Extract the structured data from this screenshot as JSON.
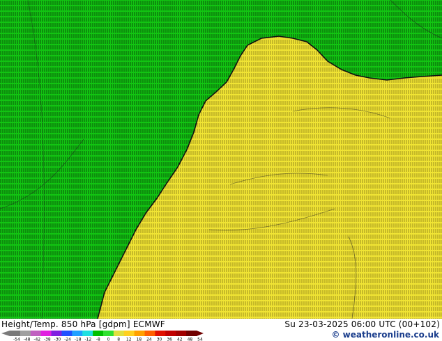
{
  "map": {
    "title_left": "Height/Temp. 850 hPa [gdpm] ECMWF",
    "title_right": "Su 23-03-2025 06:00 UTC (00+102)",
    "credit": "© weatheronline.co.uk",
    "colorbar": {
      "ticks": [
        "-54",
        "-48",
        "-42",
        "-38",
        "-30",
        "-24",
        "-18",
        "-12",
        "-8",
        "0",
        "8",
        "12",
        "18",
        "24",
        "30",
        "36",
        "42",
        "48",
        "54"
      ],
      "colors": [
        "#7a7a7a",
        "#a0a0a0",
        "#c060c0",
        "#e020e0",
        "#8020e0",
        "#2050ff",
        "#20a0ff",
        "#20e0e0",
        "#00c000",
        "#30e030",
        "#e0e040",
        "#ffd020",
        "#ffa000",
        "#ff6000",
        "#e01000",
        "#c00000",
        "#a00000",
        "#700000"
      ]
    },
    "colors": {
      "green_field": "#12c412",
      "green_dark": "#0fa80f",
      "yellow_field": "#f0e434",
      "yellow_light": "#f3e94a"
    }
  }
}
